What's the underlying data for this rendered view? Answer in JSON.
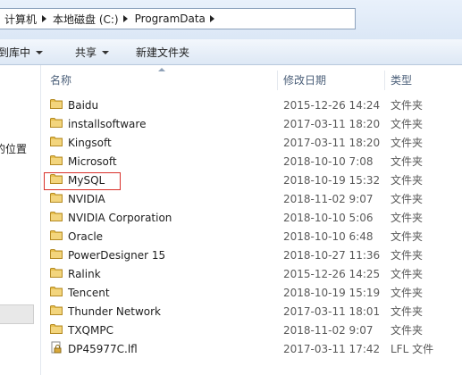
{
  "address": {
    "crumbs": [
      "计算机",
      "本地磁盘 (C:)",
      "ProgramData"
    ]
  },
  "toolbar": {
    "include_label": "到库中",
    "share_label": "共享",
    "new_folder_label": "新建文件夹"
  },
  "nav": {
    "partial_text": "的位置"
  },
  "columns": {
    "name": "名称",
    "date": "修改日期",
    "type": "类型"
  },
  "colors": {
    "folder": "#e8c04f",
    "selection_box": "#d9302a"
  },
  "files": [
    {
      "name": "Baidu",
      "date": "2015-12-26 14:24",
      "type": "文件夹",
      "icon": "folder-icon"
    },
    {
      "name": "installsoftware",
      "date": "2017-03-11 18:20",
      "type": "文件夹",
      "icon": "folder-icon"
    },
    {
      "name": "Kingsoft",
      "date": "2017-03-11 18:20",
      "type": "文件夹",
      "icon": "folder-icon"
    },
    {
      "name": "Microsoft",
      "date": "2018-10-10 7:08",
      "type": "文件夹",
      "icon": "folder-icon"
    },
    {
      "name": "MySQL",
      "date": "2018-10-19 15:32",
      "type": "文件夹",
      "icon": "folder-icon",
      "highlighted": true
    },
    {
      "name": "NVIDIA",
      "date": "2018-11-02 9:07",
      "type": "文件夹",
      "icon": "folder-icon"
    },
    {
      "name": "NVIDIA Corporation",
      "date": "2018-10-10 5:06",
      "type": "文件夹",
      "icon": "folder-icon"
    },
    {
      "name": "Oracle",
      "date": "2018-10-10 6:48",
      "type": "文件夹",
      "icon": "folder-icon"
    },
    {
      "name": "PowerDesigner 15",
      "date": "2018-10-27 11:36",
      "type": "文件夹",
      "icon": "folder-icon"
    },
    {
      "name": "Ralink",
      "date": "2015-12-26 14:25",
      "type": "文件夹",
      "icon": "folder-icon"
    },
    {
      "name": "Tencent",
      "date": "2018-10-19 15:19",
      "type": "文件夹",
      "icon": "folder-icon"
    },
    {
      "name": "Thunder Network",
      "date": "2017-03-11 18:01",
      "type": "文件夹",
      "icon": "folder-icon"
    },
    {
      "name": "TXQMPC",
      "date": "2018-11-02 9:07",
      "type": "文件夹",
      "icon": "folder-icon"
    },
    {
      "name": "DP45977C.lfl",
      "date": "2017-03-11 17:42",
      "type": "LFL 文件",
      "icon": "locked-file-icon"
    }
  ]
}
